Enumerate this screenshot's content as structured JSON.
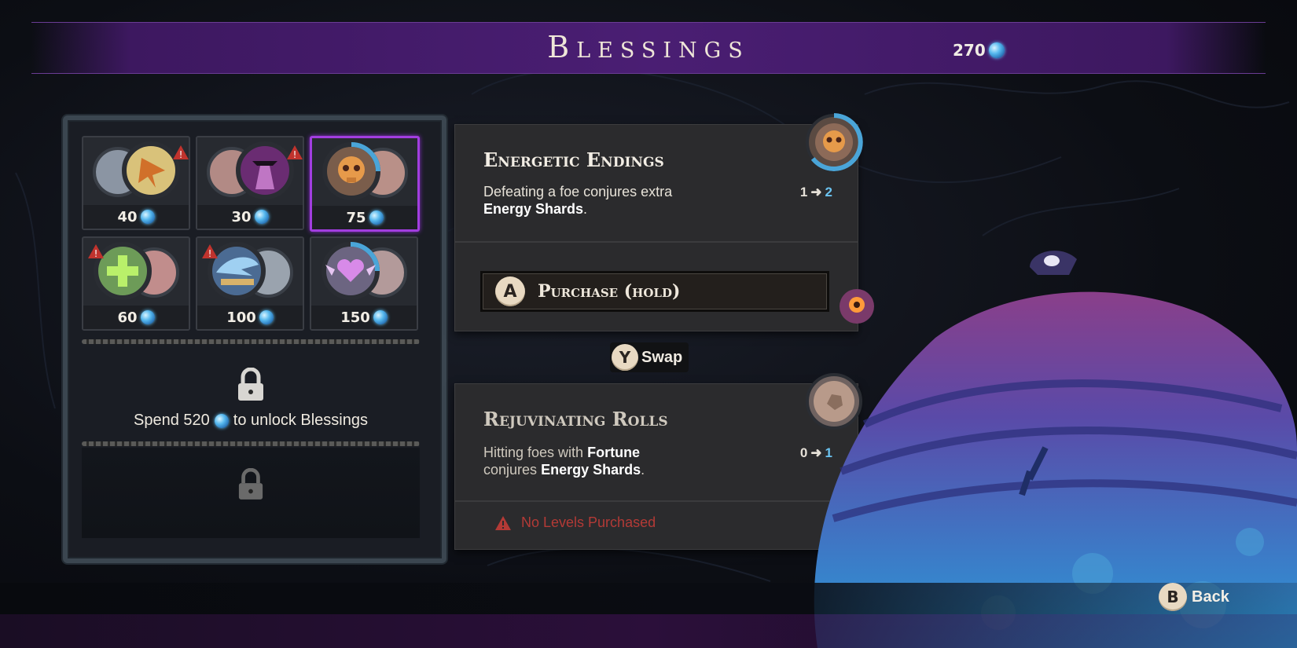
{
  "header": {
    "title": "Blessings",
    "currency_amount": "270",
    "currency_icon": "energy-shard-icon"
  },
  "blessing_slots": [
    {
      "cost": "40",
      "warning": true,
      "icon": "arrow-shatter-icon",
      "selected": false
    },
    {
      "cost": "30",
      "warning": true,
      "icon": "hooded-figure-icon",
      "selected": false
    },
    {
      "cost": "75",
      "warning": false,
      "icon": "skull-icon",
      "selected": true
    },
    {
      "cost": "60",
      "warning": true,
      "icon": "green-cross-icon",
      "selected": false
    },
    {
      "cost": "100",
      "warning": true,
      "icon": "blue-wing-icon",
      "selected": false
    },
    {
      "cost": "150",
      "warning": false,
      "icon": "winged-heart-icon",
      "selected": false
    }
  ],
  "unlock": {
    "prefix": "Spend 520",
    "suffix": "to unlock Blessings"
  },
  "primary_blessing": {
    "title": "Energetic Endings",
    "desc_plain": "Defeating a foe conjures extra",
    "desc_bold": "Energy Shards",
    "desc_end": ".",
    "level_from": "1",
    "level_to": "2",
    "purchase_button_glyph": "A",
    "purchase_label": "Purchase (hold)"
  },
  "swap": {
    "glyph": "Y",
    "label": "Swap"
  },
  "secondary_blessing": {
    "title": "Rejuvinating Rolls",
    "desc_line1_plain": "Hitting foes with",
    "desc_line1_bold": "Fortune",
    "desc_line2_plain": "conjures",
    "desc_line2_bold": "Energy Shards",
    "desc_end": ".",
    "level_from": "0",
    "level_to": "1",
    "warning_text": "No Levels Purchased"
  },
  "footer": {
    "back_glyph": "B",
    "back_label": "Back"
  },
  "colors": {
    "header_purple": "#4a1e73",
    "selected_border": "#a23ee0",
    "currency_blue": "#56b8ee",
    "warning_red": "#b33a36",
    "level_to_blue": "#6bc3f0"
  }
}
